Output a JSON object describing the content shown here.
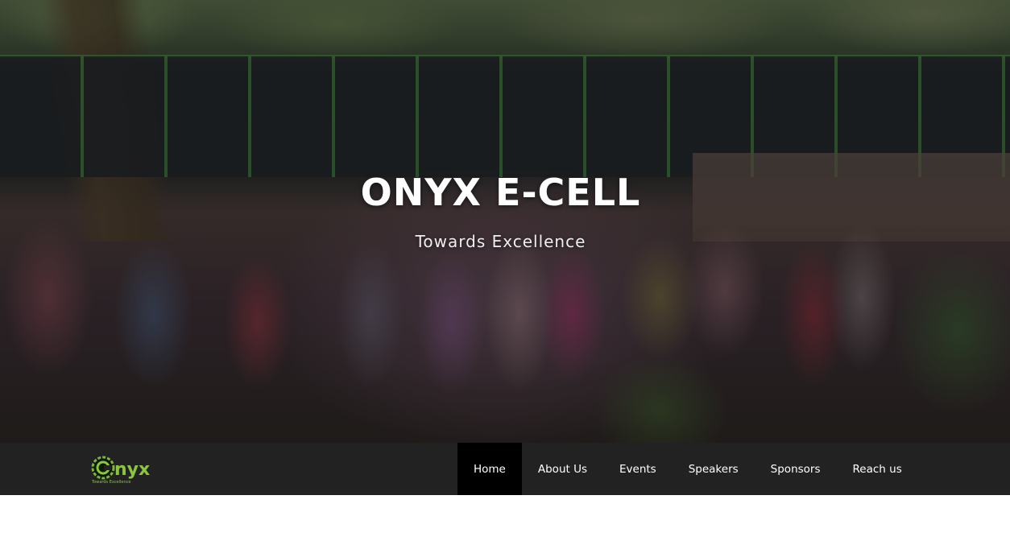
{
  "hero": {
    "title": "ONYX E-CELL",
    "subtitle": "Towards Excellence",
    "background_image": "group-photo"
  },
  "brand": {
    "logo_text": "nyx",
    "tagline": "Towards Excellence",
    "logo_color": "#8cc63f"
  },
  "nav": {
    "items": [
      {
        "label": "Home",
        "active": true
      },
      {
        "label": "About Us",
        "active": false
      },
      {
        "label": "Events",
        "active": false
      },
      {
        "label": "Speakers",
        "active": false
      },
      {
        "label": "Sponsors",
        "active": false
      },
      {
        "label": "Reach us",
        "active": false
      }
    ],
    "background": "#222222",
    "active_background": "#000000"
  }
}
